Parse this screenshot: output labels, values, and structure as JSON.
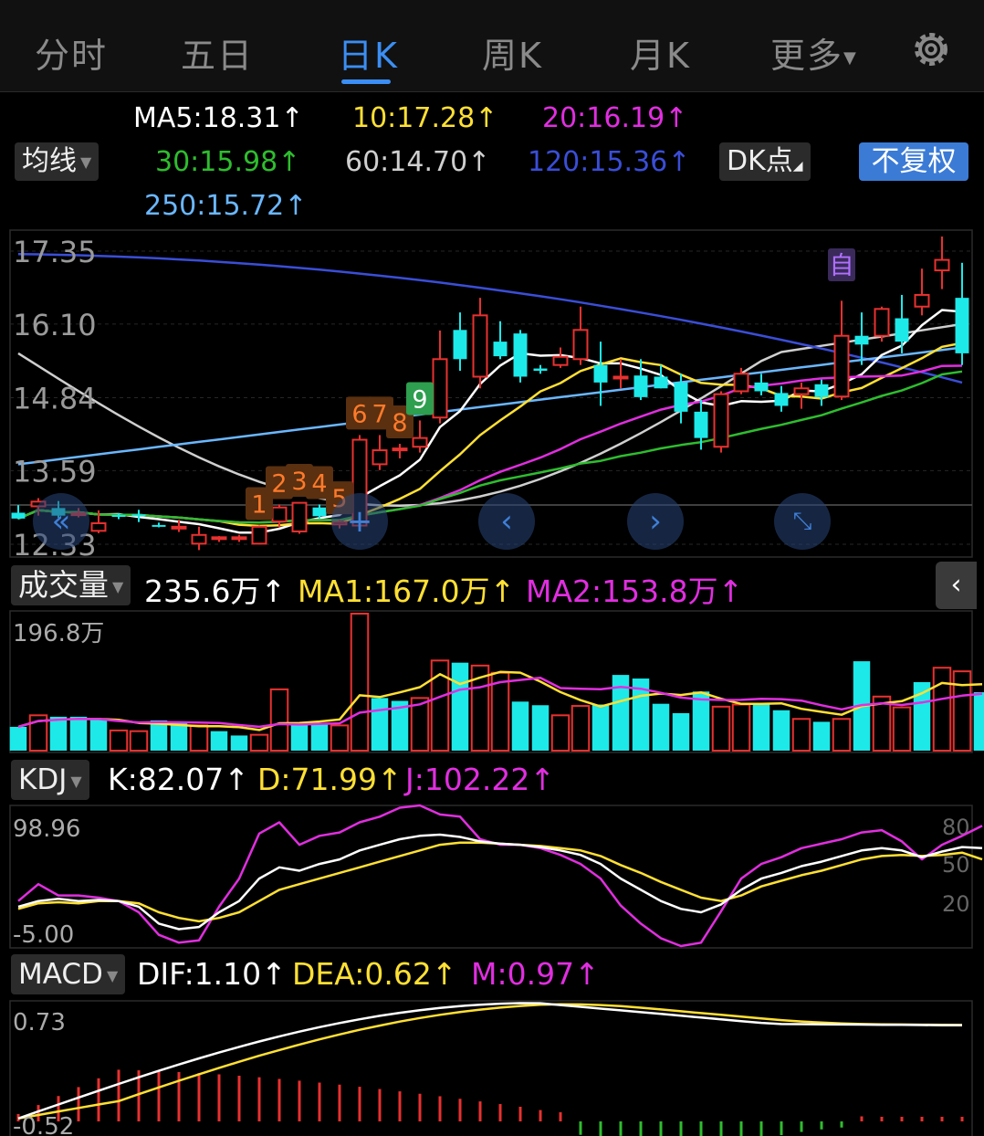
{
  "tabs": [
    {
      "label": "分时",
      "active": false
    },
    {
      "label": "五日",
      "active": false
    },
    {
      "label": "日K",
      "active": true
    },
    {
      "label": "周K",
      "active": false
    },
    {
      "label": "月K",
      "active": false
    },
    {
      "label": "更多",
      "active": false
    }
  ],
  "settings_icon": "gear-icon",
  "ma_header": {
    "selector": "均线",
    "ma5": "MA5:18.31",
    "ma10": "10:17.28",
    "ma20": "20:16.19",
    "ma30": "30:15.98",
    "ma60": "60:14.70",
    "ma120": "120:15.36",
    "ma250": "250:15.72",
    "dk_button": "DK点",
    "adjust_button": "不复权",
    "colors": {
      "ma5": "#ffffff",
      "ma10": "#ffe033",
      "ma20": "#e12ee0",
      "ma30": "#2ebd2e",
      "ma60": "#cfcfcf",
      "ma120": "#3a4ed8",
      "ma250": "#6ab7ff"
    }
  },
  "price_axis": {
    "labels": [
      "17.35",
      "16.10",
      "14.84",
      "13.59",
      "12.33"
    ]
  },
  "signal_labels": [
    "1",
    "2",
    "3",
    "4",
    "5",
    "6",
    "7",
    "8",
    "9",
    "自"
  ],
  "nav_icons": [
    "double-chevron-left-icon",
    "crosshair-plus-icon",
    "chevron-left-icon",
    "chevron-right-icon",
    "expand-icon"
  ],
  "volume": {
    "selector": "成交量",
    "value": "235.6万",
    "ma1": "MA1:167.0万",
    "ma2": "MA2:153.8万",
    "axis_max": "196.8万",
    "collapse_icon": "chevron-left-icon"
  },
  "kdj": {
    "selector": "KDJ",
    "k": "K:82.07",
    "d": "D:71.99",
    "j": "J:102.22",
    "axis_max": "98.96",
    "axis_min": "-5.00",
    "levels": [
      "80",
      "50",
      "20"
    ]
  },
  "macd": {
    "selector": "MACD",
    "dif": "DIF:1.10",
    "dea": "DEA:0.62",
    "m": "M:0.97",
    "axis_max": "0.73",
    "axis_min": "-0.52"
  },
  "arrow": "↑",
  "chart_data": {
    "type": "candlestick",
    "price_range": [
      12.33,
      17.35
    ],
    "candles": [
      {
        "o": 12.87,
        "h": 13.0,
        "l": 12.76,
        "c": 12.77
      },
      {
        "o": 12.98,
        "h": 13.12,
        "l": 12.82,
        "c": 13.06
      },
      {
        "o": 12.95,
        "h": 13.07,
        "l": 12.78,
        "c": 12.82
      },
      {
        "o": 12.86,
        "h": 12.95,
        "l": 12.79,
        "c": 12.86
      },
      {
        "o": 12.56,
        "h": 12.91,
        "l": 12.52,
        "c": 12.69
      },
      {
        "o": 12.83,
        "h": 12.86,
        "l": 12.76,
        "c": 12.8
      },
      {
        "o": 12.84,
        "h": 12.92,
        "l": 12.71,
        "c": 12.82
      },
      {
        "o": 12.66,
        "h": 12.7,
        "l": 12.62,
        "c": 12.63
      },
      {
        "o": 12.63,
        "h": 12.75,
        "l": 12.54,
        "c": 12.63
      },
      {
        "o": 12.34,
        "h": 12.63,
        "l": 12.23,
        "c": 12.49
      },
      {
        "o": 12.44,
        "h": 12.47,
        "l": 12.37,
        "c": 12.45
      },
      {
        "o": 12.45,
        "h": 12.49,
        "l": 12.37,
        "c": 12.45
      },
      {
        "o": 12.34,
        "h": 12.65,
        "l": 12.33,
        "c": 12.63
      },
      {
        "o": 12.72,
        "h": 13.01,
        "l": 12.62,
        "c": 12.96
      },
      {
        "o": 12.55,
        "h": 13.05,
        "l": 12.51,
        "c": 13.04
      },
      {
        "o": 12.96,
        "h": 13.01,
        "l": 12.77,
        "c": 12.81
      },
      {
        "o": 12.67,
        "h": 12.75,
        "l": 12.6,
        "c": 12.71
      },
      {
        "o": 12.65,
        "h": 14.2,
        "l": 12.6,
        "c": 14.12
      },
      {
        "o": 13.7,
        "h": 14.2,
        "l": 13.6,
        "c": 13.94
      },
      {
        "o": 13.95,
        "h": 14.05,
        "l": 13.8,
        "c": 13.97
      },
      {
        "o": 14.0,
        "h": 14.45,
        "l": 13.9,
        "c": 14.15
      },
      {
        "o": 14.5,
        "h": 15.99,
        "l": 14.4,
        "c": 15.5
      },
      {
        "o": 16.0,
        "h": 16.3,
        "l": 15.3,
        "c": 15.5
      },
      {
        "o": 15.2,
        "h": 16.55,
        "l": 15.0,
        "c": 16.25
      },
      {
        "o": 15.8,
        "h": 16.15,
        "l": 15.5,
        "c": 15.55
      },
      {
        "o": 15.94,
        "h": 16.0,
        "l": 15.1,
        "c": 15.2
      },
      {
        "o": 15.34,
        "h": 15.4,
        "l": 15.25,
        "c": 15.3
      },
      {
        "o": 15.4,
        "h": 15.7,
        "l": 15.35,
        "c": 15.54
      },
      {
        "o": 15.5,
        "h": 16.4,
        "l": 15.4,
        "c": 16.0
      },
      {
        "o": 15.4,
        "h": 15.8,
        "l": 14.7,
        "c": 15.1
      },
      {
        "o": 15.2,
        "h": 15.5,
        "l": 15.0,
        "c": 15.2
      },
      {
        "o": 15.22,
        "h": 15.5,
        "l": 14.8,
        "c": 14.85
      },
      {
        "o": 15.2,
        "h": 15.4,
        "l": 15.0,
        "c": 15.0
      },
      {
        "o": 15.1,
        "h": 15.25,
        "l": 14.4,
        "c": 14.6
      },
      {
        "o": 14.6,
        "h": 14.8,
        "l": 13.95,
        "c": 14.15
      },
      {
        "o": 14.0,
        "h": 14.95,
        "l": 13.9,
        "c": 14.9
      },
      {
        "o": 14.95,
        "h": 15.35,
        "l": 14.9,
        "c": 15.25
      },
      {
        "o": 15.1,
        "h": 15.25,
        "l": 14.88,
        "c": 14.95
      },
      {
        "o": 14.92,
        "h": 15.04,
        "l": 14.6,
        "c": 14.7
      },
      {
        "o": 14.9,
        "h": 15.1,
        "l": 14.65,
        "c": 15.0
      },
      {
        "o": 15.07,
        "h": 15.15,
        "l": 14.7,
        "c": 14.85
      },
      {
        "o": 14.86,
        "h": 16.5,
        "l": 14.8,
        "c": 15.9
      },
      {
        "o": 15.9,
        "h": 16.3,
        "l": 15.4,
        "c": 15.75
      },
      {
        "o": 15.9,
        "h": 16.4,
        "l": 15.8,
        "c": 16.36
      },
      {
        "o": 16.2,
        "h": 16.6,
        "l": 15.6,
        "c": 15.8
      },
      {
        "o": 16.4,
        "h": 17.05,
        "l": 16.25,
        "c": 16.6
      },
      {
        "o": 17.02,
        "h": 17.6,
        "l": 16.7,
        "c": 17.2
      },
      {
        "o": 16.55,
        "h": 17.15,
        "l": 15.4,
        "c": 15.6
      }
    ],
    "volume": [
      0.33,
      0.49,
      0.47,
      0.47,
      0.43,
      0.28,
      0.27,
      0.42,
      0.38,
      0.35,
      0.27,
      0.21,
      0.22,
      0.85,
      0.37,
      0.37,
      0.35,
      1.9,
      0.73,
      0.69,
      0.73,
      1.25,
      1.22,
      1.18,
      1.08,
      0.68,
      0.63,
      0.49,
      0.62,
      0.64,
      1.05,
      1.0,
      0.65,
      0.52,
      0.82,
      0.61,
      0.64,
      0.65,
      0.56,
      0.44,
      0.4,
      0.44,
      1.24,
      0.75,
      0.6,
      0.95,
      1.15,
      1.1,
      0.81
    ],
    "volume_up": [
      false,
      true,
      false,
      false,
      false,
      true,
      true,
      false,
      false,
      true,
      false,
      false,
      true,
      true,
      false,
      false,
      true,
      true,
      false,
      false,
      true,
      true,
      false,
      true,
      true,
      false,
      false,
      true,
      true,
      false,
      false,
      false,
      false,
      false,
      false,
      true,
      true,
      false,
      false,
      true,
      false,
      true,
      false,
      true,
      true,
      false,
      true,
      true,
      false
    ],
    "kdj_k": [
      30,
      35,
      37,
      35,
      36,
      35,
      30,
      15,
      10,
      12,
      25,
      35,
      55,
      65,
      62,
      68,
      72,
      80,
      85,
      90,
      93,
      94,
      92,
      88,
      86,
      85,
      83,
      80,
      76,
      68,
      55,
      45,
      35,
      28,
      25,
      32,
      45,
      55,
      60,
      66,
      70,
      75,
      80,
      82,
      80,
      74,
      79,
      83,
      82
    ],
    "kdj_d": [
      28,
      33,
      34,
      33,
      35,
      35,
      33,
      25,
      20,
      17,
      20,
      25,
      35,
      45,
      50,
      55,
      60,
      65,
      70,
      75,
      80,
      85,
      87,
      87,
      86,
      85,
      84,
      82,
      80,
      75,
      67,
      60,
      52,
      45,
      38,
      35,
      40,
      48,
      53,
      58,
      62,
      67,
      72,
      75,
      76,
      75,
      76,
      78,
      72
    ],
    "kdj_j": [
      35,
      50,
      40,
      40,
      38,
      35,
      25,
      5,
      -2,
      0,
      30,
      55,
      95,
      105,
      85,
      93,
      96,
      105,
      110,
      118,
      120,
      112,
      110,
      90,
      85,
      85,
      82,
      76,
      68,
      55,
      31,
      15,
      2,
      -5,
      -2,
      26,
      55,
      68,
      74,
      82,
      86,
      90,
      96,
      98,
      88,
      72,
      85,
      93,
      102
    ]
  }
}
